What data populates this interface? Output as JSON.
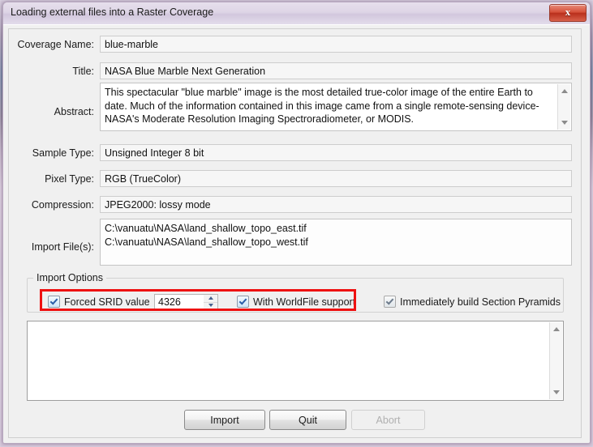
{
  "window": {
    "title": "Loading external files into a Raster Coverage",
    "close_glyph": "x"
  },
  "fields": {
    "coverage_name": {
      "label": "Coverage Name:",
      "value": "blue-marble"
    },
    "title": {
      "label": "Title:",
      "value": "NASA Blue Marble Next Generation"
    },
    "abstract": {
      "label": "Abstract:",
      "value": "This spectacular \"blue marble\" image is the most detailed true-color image of the entire Earth to date. Much of the information contained in this image came from a single remote-sensing device-NASA's Moderate Resolution Imaging Spectroradiometer, or MODIS."
    },
    "sample_type": {
      "label": "Sample Type:",
      "value": "Unsigned Integer 8 bit"
    },
    "pixel_type": {
      "label": "Pixel Type:",
      "value": "RGB (TrueColor)"
    },
    "compression": {
      "label": "Compression:",
      "value": "JPEG2000: lossy mode"
    },
    "import_files": {
      "label": "Import File(s):",
      "value": "C:\\vanuatu\\NASA\\land_shallow_topo_east.tif\nC:\\vanuatu\\NASA\\land_shallow_topo_west.tif"
    }
  },
  "import_options": {
    "group_label": "Import Options",
    "forced_srid": {
      "label": "Forced SRID value",
      "checked": true,
      "value": "4326"
    },
    "worldfile": {
      "label": "With WorldFile support",
      "checked": true
    },
    "pyramids": {
      "label": "Immediately build Section Pyramids",
      "checked": true
    }
  },
  "log": {
    "value": ""
  },
  "buttons": {
    "import": "Import",
    "quit": "Quit",
    "abort": "Abort"
  },
  "annotation": {
    "color": "#ee1111"
  }
}
